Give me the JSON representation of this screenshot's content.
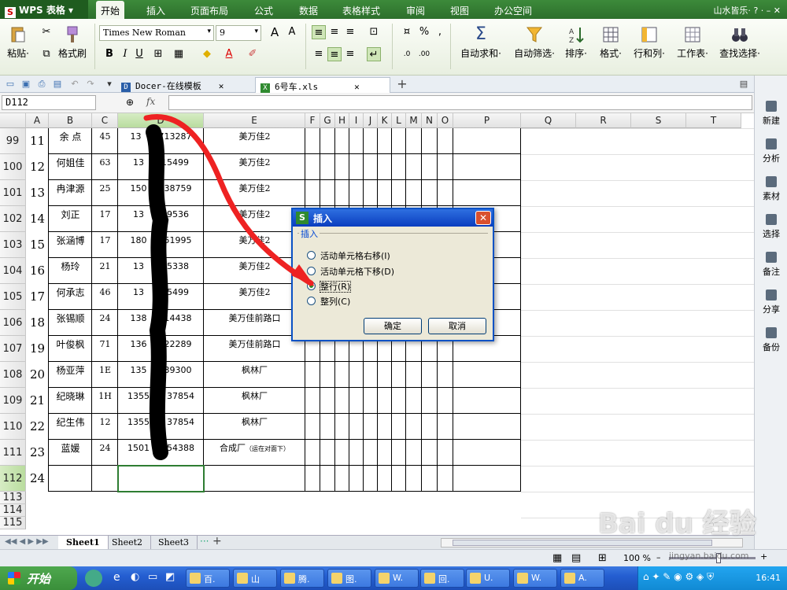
{
  "menubar": {
    "app_name": "WPS 表格",
    "items": [
      "开始",
      "插入",
      "页面布局",
      "公式",
      "数据",
      "表格样式",
      "审阅",
      "视图",
      "办公空间"
    ],
    "user": "山水皆乐·"
  },
  "ribbon": {
    "paste": "粘贴·",
    "format_painter": "格式刷",
    "font_name": "Times New Roman",
    "font_size": "9",
    "autosum": "自动求和·",
    "autofilter": "自动筛选·",
    "sort": "排序·",
    "format": "格式·",
    "row_col": "行和列·",
    "worksheet": "工作表·",
    "find_select": "查找选择·"
  },
  "tabs": {
    "items": [
      "Docer-在线模板",
      "6号车.xls"
    ]
  },
  "formula": {
    "name_box": "D112",
    "fx": "fx"
  },
  "columns": [
    "A",
    "B",
    "C",
    "D",
    "E",
    "F",
    "G",
    "H",
    "I",
    "J",
    "K",
    "L",
    "M",
    "N",
    "O",
    "P",
    "Q",
    "R",
    "S",
    "T"
  ],
  "rows": [
    {
      "num": "99",
      "a": "11",
      "b": "余 点",
      "c": "45",
      "d": "13  713287",
      "e": "美万佳2"
    },
    {
      "num": "100",
      "a": "12",
      "b": "何姐佳",
      "c": "63",
      "d": "13  15499",
      "e": "美万佳2"
    },
    {
      "num": "101",
      "a": "13",
      "b": "冉津源",
      "c": "25",
      "d": "150  38759",
      "e": "美万佳2"
    },
    {
      "num": "102",
      "a": "14",
      "b": "刘正",
      "c": "17",
      "d": "13  69536",
      "e": "美万佳2"
    },
    {
      "num": "103",
      "a": "15",
      "b": "张涵博",
      "c": "17",
      "d": "180  51995",
      "e": "美万佳2"
    },
    {
      "num": "104",
      "a": "16",
      "b": "杨玲",
      "c": "21",
      "d": "13  85338",
      "e": "美万佳2"
    },
    {
      "num": "105",
      "a": "17",
      "b": "何承志",
      "c": "46",
      "d": "13  15499",
      "e": "美万佳2"
    },
    {
      "num": "106",
      "a": "18",
      "b": "张锡顺",
      "c": "24",
      "d": "138  14438",
      "e": "美万佳前路口"
    },
    {
      "num": "107",
      "a": "19",
      "b": "叶俊枫",
      "c": "71",
      "d": "136  22289",
      "e": "美万佳前路口"
    },
    {
      "num": "108",
      "a": "20",
      "b": "杨亚萍",
      "c": "1E",
      "d": "135  39300",
      "e": "枫林厂"
    },
    {
      "num": "109",
      "a": "21",
      "b": "纪晓琳",
      "c": "1H",
      "d": "1355  37854",
      "e": "枫林厂"
    },
    {
      "num": "110",
      "a": "22",
      "b": "纪生伟",
      "c": "12",
      "d": "1355  37854",
      "e": "枫林厂"
    },
    {
      "num": "111",
      "a": "23",
      "b": "蓝媛",
      "c": "24",
      "d": "1501  54388",
      "e": "合成厂",
      "e_note": "（运在对面下）"
    },
    {
      "num": "112",
      "a": "24",
      "b": "",
      "c": "",
      "d": "",
      "e": ""
    },
    {
      "num": "113"
    },
    {
      "num": "114"
    },
    {
      "num": "115"
    }
  ],
  "dialog": {
    "title": "插入",
    "group_label": "插入",
    "options": [
      "活动单元格右移(I)",
      "活动单元格下移(D)",
      "整行(R)",
      "整列(C)"
    ],
    "selected_index": 2,
    "ok": "确定",
    "cancel": "取消"
  },
  "sheets": [
    "Sheet1",
    "Sheet2",
    "Sheet3"
  ],
  "rightpane": [
    "新建",
    "分析",
    "素材",
    "选择",
    "备注",
    "分享",
    "备份"
  ],
  "status": {
    "zoom": "100 %"
  },
  "taskbar": {
    "start": "开始",
    "buttons": [
      "百.",
      "山",
      "腾.",
      "图.",
      "W.",
      "回.",
      "U.",
      "W.",
      "A."
    ],
    "clock": "16:41"
  },
  "watermark": {
    "logo": "Bai du 经验",
    "url": "jingyan.baidu.com"
  },
  "colors": {
    "brand_green": "#2d6f2c",
    "selection_green": "#2e7d32",
    "annotation_red": "#ee2222",
    "xp_blue": "#245ed1"
  }
}
